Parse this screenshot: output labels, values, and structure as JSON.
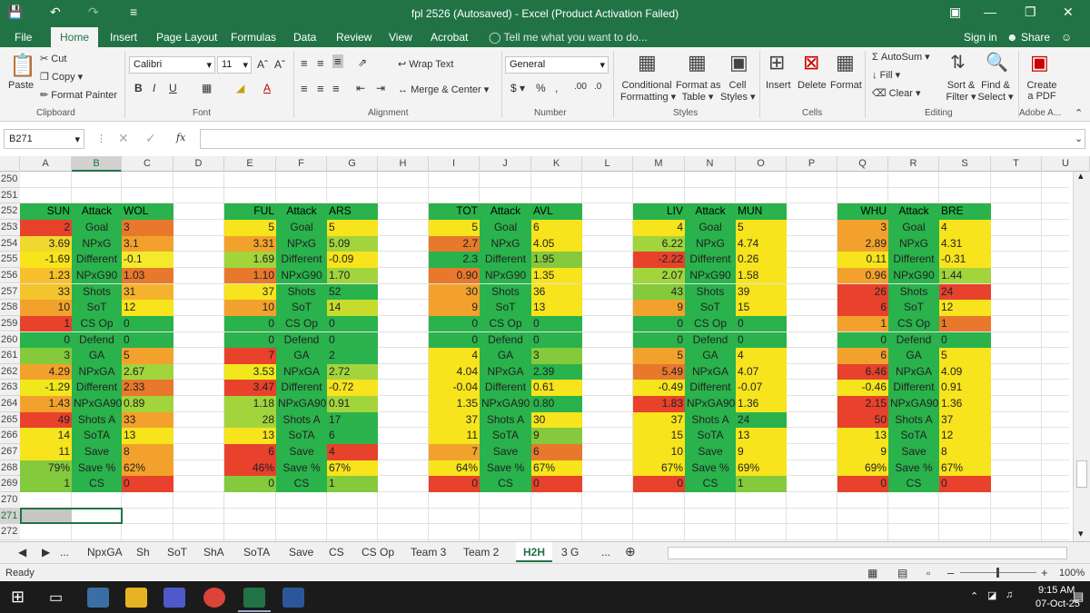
{
  "window": {
    "title": "fpl 2526 (Autosaved) - Excel (Product Activation Failed)"
  },
  "ribbon_tabs": [
    "File",
    "Home",
    "Insert",
    "Page Layout",
    "Formulas",
    "Data",
    "Review",
    "View",
    "Acrobat"
  ],
  "active_tab": "Home",
  "tell_me": "Tell me what you want to do...",
  "account": {
    "sign_in": "Sign in",
    "share": "Share"
  },
  "ribbon": {
    "clipboard": {
      "paste": "Paste",
      "cut": "Cut",
      "copy": "Copy",
      "format_painter": "Format Painter",
      "label": "Clipboard"
    },
    "font": {
      "name": "Calibri",
      "size": "11",
      "label": "Font"
    },
    "alignment": {
      "wrap": "Wrap Text",
      "merge": "Merge & Center",
      "label": "Alignment"
    },
    "number": {
      "format": "General",
      "label": "Number"
    },
    "styles": {
      "conditional": "Conditional",
      "conditional2": "Formatting",
      "format_as": "Format as",
      "format_as2": "Table",
      "cell": "Cell",
      "cell2": "Styles",
      "label": "Styles"
    },
    "cells": {
      "insert": "Insert",
      "delete": "Delete",
      "format": "Format",
      "label": "Cells"
    },
    "editing": {
      "autosum": "AutoSum",
      "fill": "Fill",
      "clear": "Clear",
      "sort": "Sort &",
      "sort2": "Filter",
      "find": "Find &",
      "find2": "Select",
      "label": "Editing"
    },
    "adobe": {
      "create": "Create",
      "create2": "a PDF",
      "label": "Adobe A..."
    }
  },
  "name_box": "B271",
  "fx": "fx",
  "columns": [
    "A",
    "B",
    "C",
    "D",
    "E",
    "F",
    "G",
    "H",
    "I",
    "J",
    "K",
    "L",
    "M",
    "N",
    "O",
    "P",
    "Q",
    "R",
    "S",
    "T",
    "U"
  ],
  "rows": [
    "250",
    "251",
    "252",
    "253",
    "254",
    "255",
    "256",
    "257",
    "258",
    "259",
    "260",
    "261",
    "262",
    "263",
    "264",
    "265",
    "266",
    "267",
    "268",
    "269",
    "270",
    "271",
    "272"
  ],
  "blocks": [
    {
      "home": "SUN",
      "mid": "Attack",
      "away": "WOL",
      "rows": [
        [
          "2",
          "Goal",
          "3"
        ],
        [
          "3.69",
          "NPxG",
          "3.1"
        ],
        [
          "-1.69",
          "Different",
          "-0.1"
        ],
        [
          "1.23",
          "NPxG90",
          "1.03"
        ],
        [
          "33",
          "Shots",
          "31"
        ],
        [
          "10",
          "SoT",
          "12"
        ],
        [
          "1",
          "CS Op",
          "0"
        ],
        [
          "0",
          "Defend",
          "0"
        ],
        [
          "3",
          "GA",
          "5"
        ],
        [
          "4.29",
          "NPxGA",
          "2.67"
        ],
        [
          "-1.29",
          "Different",
          "2.33"
        ],
        [
          "1.43",
          "NPxGA90",
          "0.89"
        ],
        [
          "49",
          "Shots A",
          "33"
        ],
        [
          "14",
          "SoTA",
          "13"
        ],
        [
          "11",
          "Save",
          "8"
        ],
        [
          "79%",
          "Save %",
          "62%"
        ],
        [
          "1",
          "CS",
          "0"
        ]
      ],
      "colors": [
        [
          "#e8412c",
          "#e8782c"
        ],
        [
          "#f0d82f",
          "#f2a22c"
        ],
        [
          "#f7e41c",
          "#f4ea2c"
        ],
        [
          "#f8c12c",
          "#e8782c"
        ],
        [
          "#f4c42c",
          "#f5b22c"
        ],
        [
          "#f2a22c",
          "#f7e41c"
        ],
        [
          "#e8412c",
          "#2ab24c"
        ],
        [
          "#2ab24c",
          "#2ab24c"
        ],
        [
          "#84ca3c",
          "#f2a22c"
        ],
        [
          "#f2a22c",
          "#a2d43c"
        ],
        [
          "#f0e81c",
          "#e8782c"
        ],
        [
          "#f2a22c",
          "#a2d43c"
        ],
        [
          "#e8412c",
          "#f2a22c"
        ],
        [
          "#f7e41c",
          "#f7e41c"
        ],
        [
          "#f7e41c",
          "#f2a22c"
        ],
        [
          "#84ca3c",
          "#f2a22c"
        ],
        [
          "#84ca3c",
          "#e8412c"
        ]
      ]
    },
    {
      "home": "FUL",
      "mid": "Attack",
      "away": "ARS",
      "rows": [
        [
          "5",
          "Goal",
          "5"
        ],
        [
          "3.31",
          "NPxG",
          "5.09"
        ],
        [
          "1.69",
          "Different",
          "-0.09"
        ],
        [
          "1.10",
          "NPxG90",
          "1.70"
        ],
        [
          "37",
          "Shots",
          "52"
        ],
        [
          "10",
          "SoT",
          "14"
        ],
        [
          "0",
          "CS Op",
          "0"
        ],
        [
          "0",
          "Defend",
          "0"
        ],
        [
          "7",
          "GA",
          "2"
        ],
        [
          "3.53",
          "NPxGA",
          "2.72"
        ],
        [
          "3.47",
          "Different",
          "-0.72"
        ],
        [
          "1.18",
          "NPxGA90",
          "0.91"
        ],
        [
          "28",
          "Shots A",
          "17"
        ],
        [
          "13",
          "SoTA",
          "6"
        ],
        [
          "6",
          "Save",
          "4"
        ],
        [
          "46%",
          "Save %",
          "67%"
        ],
        [
          "0",
          "CS",
          "1"
        ]
      ],
      "colors": [
        [
          "#f7e41c",
          "#f7e41c"
        ],
        [
          "#f2a22c",
          "#a2d43c"
        ],
        [
          "#a2d43c",
          "#f7e41c"
        ],
        [
          "#e8782c",
          "#a2d43c"
        ],
        [
          "#f7e41c",
          "#2ab24c"
        ],
        [
          "#f2a22c",
          "#c6dc2c"
        ],
        [
          "#2ab24c",
          "#2ab24c"
        ],
        [
          "#2ab24c",
          "#2ab24c"
        ],
        [
          "#e8412c",
          "#2ab24c"
        ],
        [
          "#f0e81c",
          "#a2d43c"
        ],
        [
          "#e8412c",
          "#f7e41c"
        ],
        [
          "#a2d43c",
          "#a2d43c"
        ],
        [
          "#a2d43c",
          "#2ab24c"
        ],
        [
          "#f7e41c",
          "#2ab24c"
        ],
        [
          "#e8412c",
          "#e8412c"
        ],
        [
          "#e8412c",
          "#f7e41c"
        ],
        [
          "#84ca3c",
          "#84ca3c"
        ]
      ]
    },
    {
      "home": "TOT",
      "mid": "Attack",
      "away": "AVL",
      "rows": [
        [
          "5",
          "Goal",
          "6"
        ],
        [
          "2.7",
          "NPxG",
          "4.05"
        ],
        [
          "2.3",
          "Different",
          "1.95"
        ],
        [
          "0.90",
          "NPxG90",
          "1.35"
        ],
        [
          "30",
          "Shots",
          "36"
        ],
        [
          "9",
          "SoT",
          "13"
        ],
        [
          "0",
          "CS Op",
          "0"
        ],
        [
          "0",
          "Defend",
          "0"
        ],
        [
          "4",
          "GA",
          "3"
        ],
        [
          "4.04",
          "NPxGA",
          "2.39"
        ],
        [
          "-0.04",
          "Different",
          "0.61"
        ],
        [
          "1.35",
          "NPxGA90",
          "0.80"
        ],
        [
          "37",
          "Shots A",
          "30"
        ],
        [
          "11",
          "SoTA",
          "9"
        ],
        [
          "7",
          "Save",
          "6"
        ],
        [
          "64%",
          "Save %",
          "67%"
        ],
        [
          "0",
          "CS",
          "0"
        ]
      ],
      "colors": [
        [
          "#f7e41c",
          "#f7e41c"
        ],
        [
          "#e8782c",
          "#f7e41c"
        ],
        [
          "#2ab24c",
          "#84ca3c"
        ],
        [
          "#e8782c",
          "#f7e41c"
        ],
        [
          "#f2a22c",
          "#f7e41c"
        ],
        [
          "#f2a22c",
          "#f7e41c"
        ],
        [
          "#2ab24c",
          "#2ab24c"
        ],
        [
          "#2ab24c",
          "#2ab24c"
        ],
        [
          "#f7e41c",
          "#84ca3c"
        ],
        [
          "#f7e41c",
          "#2ab24c"
        ],
        [
          "#f7e41c",
          "#f7e41c"
        ],
        [
          "#f7e41c",
          "#2ab24c"
        ],
        [
          "#f7e41c",
          "#f7e41c"
        ],
        [
          "#f7e41c",
          "#84ca3c"
        ],
        [
          "#f2a22c",
          "#e8782c"
        ],
        [
          "#f7e41c",
          "#f7e41c"
        ],
        [
          "#e8412c",
          "#e8412c"
        ]
      ]
    },
    {
      "home": "LIV",
      "mid": "Attack",
      "away": "MUN",
      "rows": [
        [
          "4",
          "Goal",
          "5"
        ],
        [
          "6.22",
          "NPxG",
          "4.74"
        ],
        [
          "-2.22",
          "Different",
          "0.26"
        ],
        [
          "2.07",
          "NPxG90",
          "1.58"
        ],
        [
          "43",
          "Shots",
          "39"
        ],
        [
          "9",
          "SoT",
          "15"
        ],
        [
          "0",
          "CS Op",
          "0"
        ],
        [
          "0",
          "Defend",
          "0"
        ],
        [
          "5",
          "GA",
          "4"
        ],
        [
          "5.49",
          "NPxGA",
          "4.07"
        ],
        [
          "-0.49",
          "Different",
          "-0.07"
        ],
        [
          "1.83",
          "NPxGA90",
          "1.36"
        ],
        [
          "37",
          "Shots A",
          "24"
        ],
        [
          "15",
          "SoTA",
          "13"
        ],
        [
          "10",
          "Save",
          "9"
        ],
        [
          "67%",
          "Save %",
          "69%"
        ],
        [
          "0",
          "CS",
          "1"
        ]
      ],
      "colors": [
        [
          "#f7e41c",
          "#f7e41c"
        ],
        [
          "#a2d43c",
          "#f7e41c"
        ],
        [
          "#e8412c",
          "#f7e41c"
        ],
        [
          "#a2d43c",
          "#f7e41c"
        ],
        [
          "#84ca3c",
          "#f7e41c"
        ],
        [
          "#f2a22c",
          "#f7e41c"
        ],
        [
          "#2ab24c",
          "#2ab24c"
        ],
        [
          "#2ab24c",
          "#2ab24c"
        ],
        [
          "#f2a22c",
          "#f7e41c"
        ],
        [
          "#e8782c",
          "#f7e41c"
        ],
        [
          "#f7e41c",
          "#f7e41c"
        ],
        [
          "#e8412c",
          "#f7e41c"
        ],
        [
          "#f7e41c",
          "#2ab24c"
        ],
        [
          "#f7e41c",
          "#f7e41c"
        ],
        [
          "#f7e41c",
          "#f7e41c"
        ],
        [
          "#f7e41c",
          "#f7e41c"
        ],
        [
          "#e8412c",
          "#84ca3c"
        ]
      ]
    },
    {
      "home": "WHU",
      "mid": "Attack",
      "away": "BRE",
      "rows": [
        [
          "3",
          "Goal",
          "4"
        ],
        [
          "2.89",
          "NPxG",
          "4.31"
        ],
        [
          "0.11",
          "Different",
          "-0.31"
        ],
        [
          "0.96",
          "NPxG90",
          "1.44"
        ],
        [
          "26",
          "Shots",
          "24"
        ],
        [
          "6",
          "SoT",
          "12"
        ],
        [
          "1",
          "CS Op",
          "1"
        ],
        [
          "0",
          "Defend",
          "0"
        ],
        [
          "6",
          "GA",
          "5"
        ],
        [
          "6.46",
          "NPxGA",
          "4.09"
        ],
        [
          "-0.46",
          "Different",
          "0.91"
        ],
        [
          "2.15",
          "NPxGA90",
          "1.36"
        ],
        [
          "50",
          "Shots A",
          "37"
        ],
        [
          "13",
          "SoTA",
          "12"
        ],
        [
          "9",
          "Save",
          "8"
        ],
        [
          "69%",
          "Save %",
          "67%"
        ],
        [
          "0",
          "CS",
          "0"
        ]
      ],
      "colors": [
        [
          "#f2a22c",
          "#f7e41c"
        ],
        [
          "#f2a22c",
          "#f7e41c"
        ],
        [
          "#f7e41c",
          "#f7e41c"
        ],
        [
          "#f2a22c",
          "#a2d43c"
        ],
        [
          "#e8412c",
          "#e8412c"
        ],
        [
          "#e8412c",
          "#f7e41c"
        ],
        [
          "#f2a22c",
          "#e8782c"
        ],
        [
          "#2ab24c",
          "#2ab24c"
        ],
        [
          "#f2a22c",
          "#f7e41c"
        ],
        [
          "#e8412c",
          "#f7e41c"
        ],
        [
          "#f7e41c",
          "#f7e41c"
        ],
        [
          "#e8412c",
          "#f7e41c"
        ],
        [
          "#e8412c",
          "#f7e41c"
        ],
        [
          "#f7e41c",
          "#f7e41c"
        ],
        [
          "#f7e41c",
          "#f7e41c"
        ],
        [
          "#f7e41c",
          "#f7e41c"
        ],
        [
          "#e8412c",
          "#e8412c"
        ]
      ]
    }
  ],
  "header_color": "#2ab24c",
  "sheet_tabs": [
    "...",
    "NpxGA",
    "Sh",
    "SoT",
    "ShA",
    "SoTA",
    "Save",
    "CS",
    "CS Op",
    "Team 3",
    "Team 2",
    "H2H",
    "3 G",
    "..."
  ],
  "active_sheet": "H2H",
  "status": {
    "ready": "Ready",
    "zoom": "100%"
  },
  "taskbar": {
    "time": "9:15 AM",
    "date": "07-Oct-25"
  }
}
